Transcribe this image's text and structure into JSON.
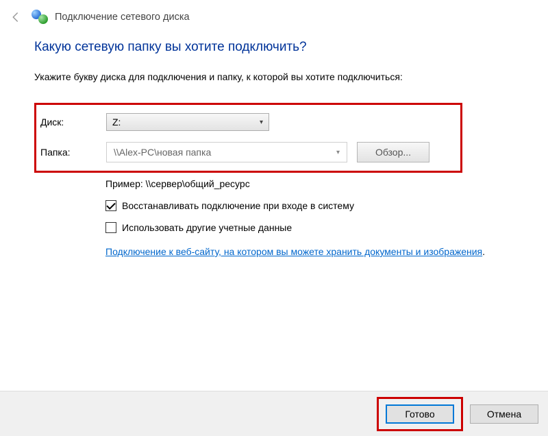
{
  "header": {
    "title": "Подключение сетевого диска"
  },
  "main": {
    "heading": "Какую сетевую папку вы хотите подключить?",
    "instruction": "Укажите букву диска для подключения и папку, к которой вы хотите подключиться:",
    "disk": {
      "label": "Диск:",
      "value": "Z:"
    },
    "folder": {
      "label": "Папка:",
      "value": "\\\\Alex-PC\\новая папка",
      "browse": "Обзор..."
    },
    "example": "Пример: \\\\сервер\\общий_ресурс",
    "checkbox_reconnect": {
      "label": "Восстанавливать подключение при входе в систему",
      "checked": true
    },
    "checkbox_credentials": {
      "label": "Использовать другие учетные данные",
      "checked": false
    },
    "link_text": "Подключение к веб-сайту, на котором вы можете хранить документы и изображения",
    "link_period": "."
  },
  "footer": {
    "finish": "Готово",
    "cancel": "Отмена"
  }
}
